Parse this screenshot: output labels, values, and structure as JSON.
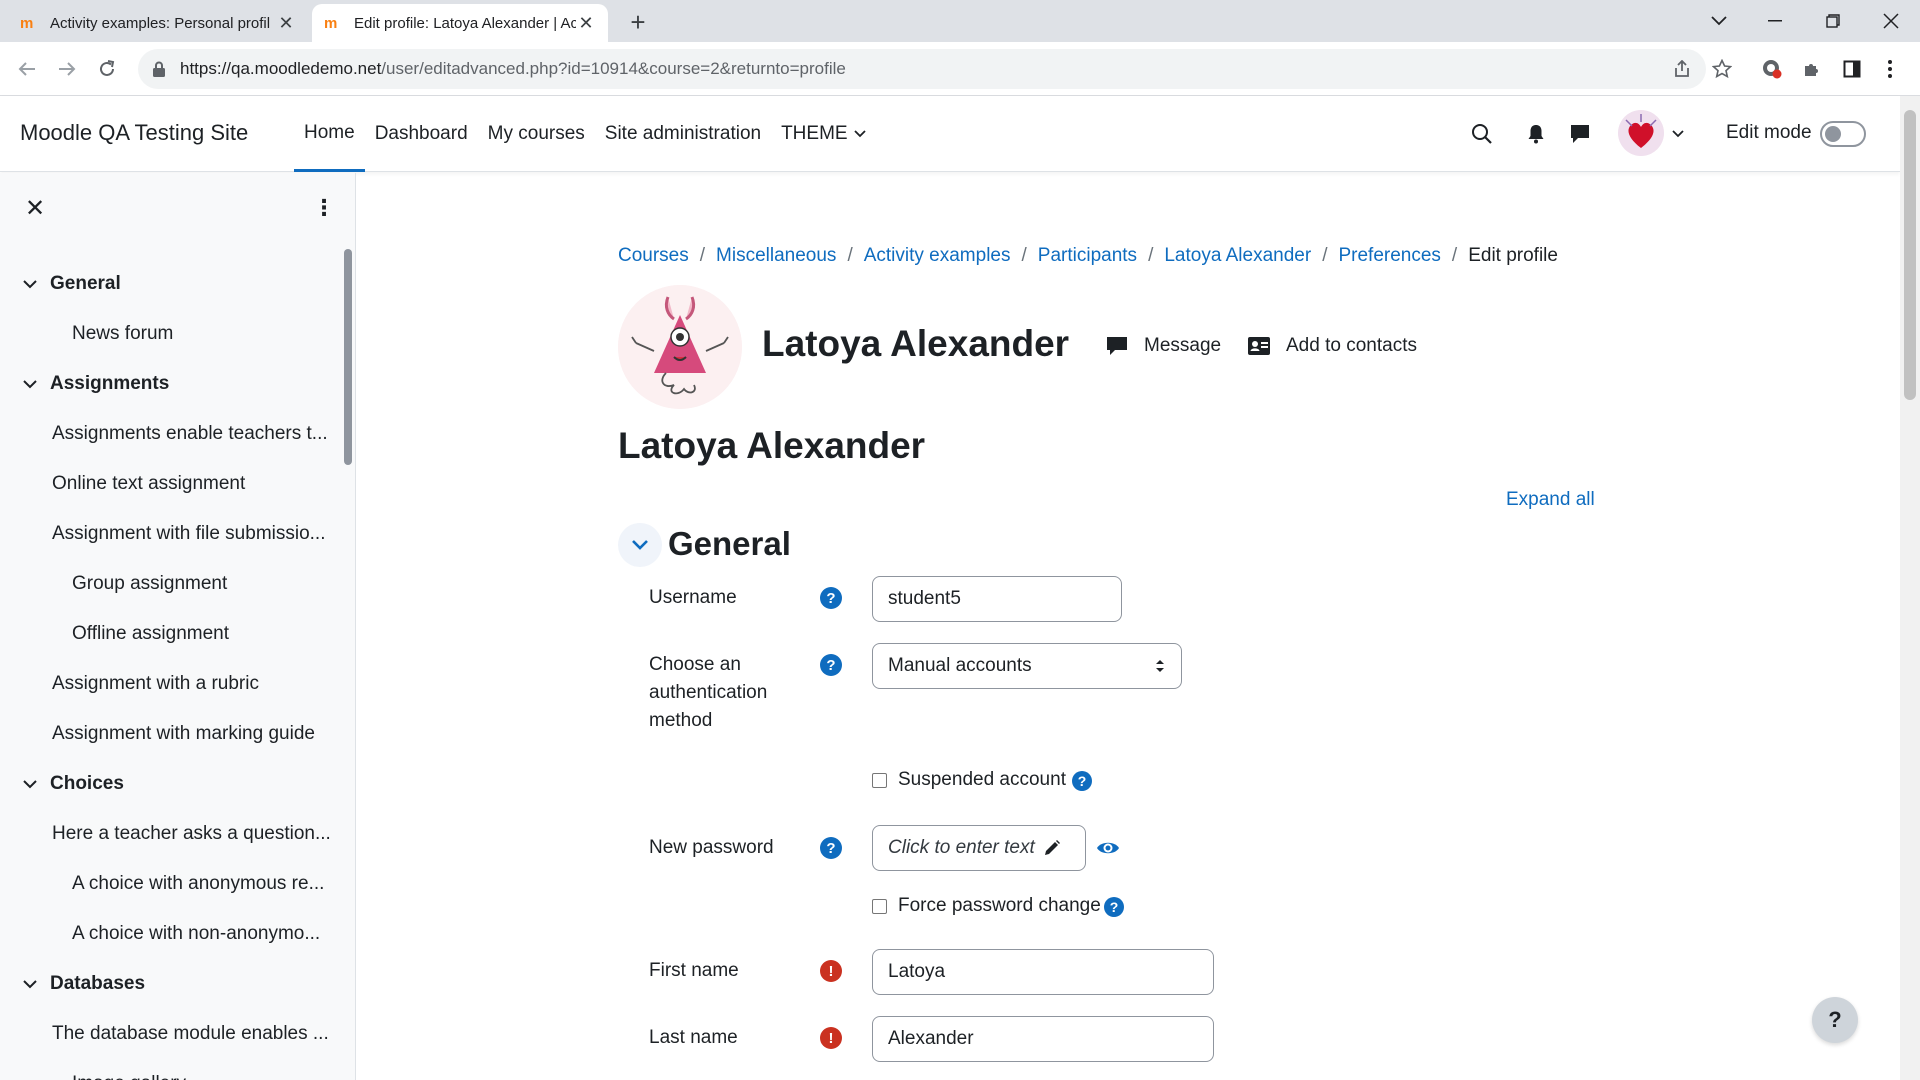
{
  "browser": {
    "tabs": [
      {
        "title": "Activity examples: Personal profil",
        "active": false
      },
      {
        "title": "Edit profile: Latoya Alexander | Ac",
        "active": true
      }
    ],
    "url_host": "https://qa.moodledemo.net",
    "url_path": "/user/editadvanced.php?id=10914&course=2&returnto=profile"
  },
  "navbar": {
    "site_name": "Moodle QA Testing Site",
    "items": [
      {
        "label": "Home",
        "active": true
      },
      {
        "label": "Dashboard",
        "active": false
      },
      {
        "label": "My courses",
        "active": false
      },
      {
        "label": "Site administration",
        "active": false
      },
      {
        "label": "THEME",
        "active": false,
        "dropdown": true
      }
    ],
    "edit_mode_label": "Edit mode",
    "edit_mode_on": false
  },
  "drawer": {
    "items": [
      {
        "label": "General",
        "type": "section"
      },
      {
        "label": "News forum",
        "type": "l2"
      },
      {
        "label": "Assignments",
        "type": "section"
      },
      {
        "label": "Assignments enable teachers t...",
        "type": "l1"
      },
      {
        "label": "Online text assignment",
        "type": "l1"
      },
      {
        "label": "Assignment with file submissio...",
        "type": "l1"
      },
      {
        "label": "Group assignment",
        "type": "l2"
      },
      {
        "label": "Offline assignment",
        "type": "l2"
      },
      {
        "label": "Assignment with a rubric",
        "type": "l1"
      },
      {
        "label": "Assignment with marking guide",
        "type": "l1"
      },
      {
        "label": "Choices",
        "type": "section"
      },
      {
        "label": "Here a teacher asks a question...",
        "type": "l1"
      },
      {
        "label": "A choice with anonymous re...",
        "type": "l2"
      },
      {
        "label": "A choice with non-anonymo...",
        "type": "l2"
      },
      {
        "label": "Databases",
        "type": "section"
      },
      {
        "label": "The database module enables ...",
        "type": "l1"
      },
      {
        "label": "Image gallery",
        "type": "l2"
      }
    ]
  },
  "breadcrumb": [
    "Courses",
    "Miscellaneous",
    "Activity examples",
    "Participants",
    "Latoya Alexander",
    "Preferences",
    "Edit profile"
  ],
  "profile": {
    "name": "Latoya Alexander",
    "message_label": "Message",
    "add_contact_label": "Add to contacts"
  },
  "page": {
    "heading": "Latoya Alexander",
    "expand_all": "Expand all",
    "section_title": "General"
  },
  "form": {
    "username_label": "Username",
    "username_value": "student5",
    "auth_label": "Choose an authentication method",
    "auth_value": "Manual accounts",
    "suspended_label": "Suspended account",
    "new_password_label": "New password",
    "new_password_placeholder": "Click to enter text",
    "force_change_label": "Force password change",
    "first_name_label": "First name",
    "first_name_value": "Latoya",
    "last_name_label": "Last name",
    "last_name_value": "Alexander"
  },
  "help_fab": "?",
  "colors": {
    "link": "#0f6cbf",
    "required": "#ca3120",
    "text": "#1d2125"
  }
}
